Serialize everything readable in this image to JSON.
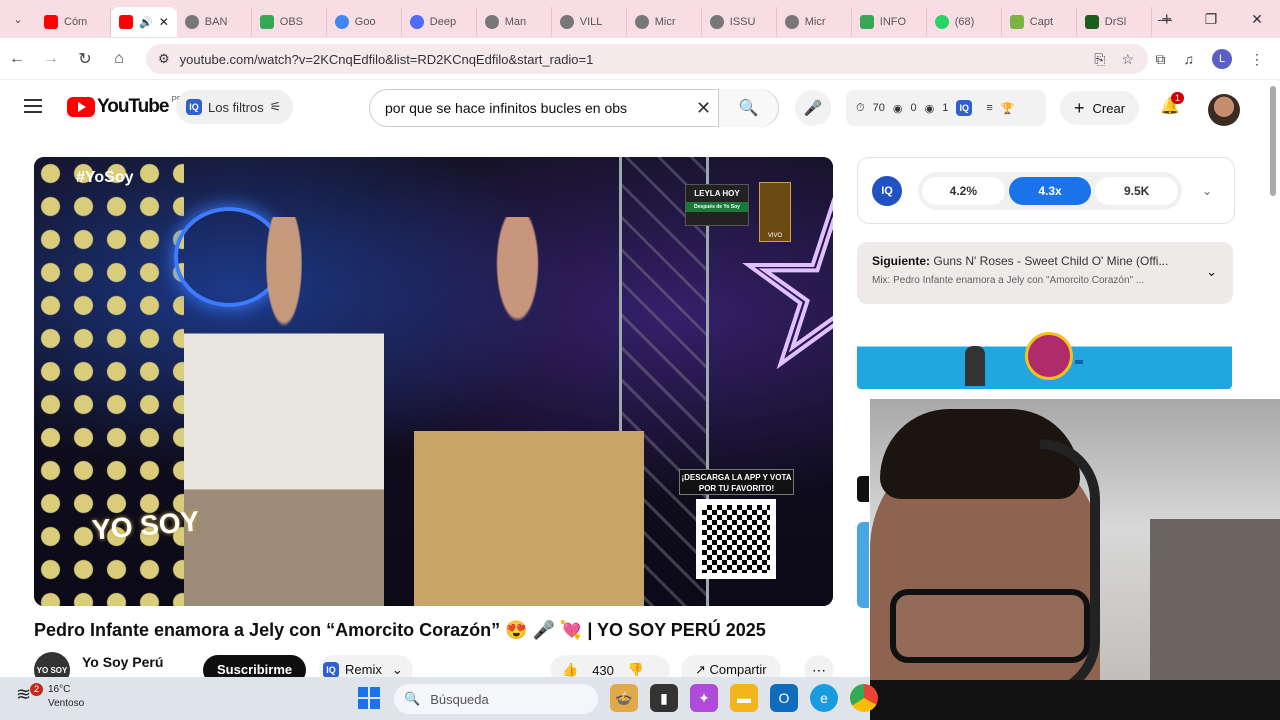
{
  "browser": {
    "tabs": [
      {
        "label": "Cóm",
        "color": "#ff0000"
      },
      {
        "label": "",
        "color": "#ff0000",
        "active": true
      },
      {
        "label": "BAN",
        "color": "#555555"
      },
      {
        "label": "OBS",
        "color": "#34a853"
      },
      {
        "label": "Goo",
        "color": "#4285f4"
      },
      {
        "label": "Deep",
        "color": "#4d6bfe"
      },
      {
        "label": "Man",
        "color": "#555555"
      },
      {
        "label": "VILL",
        "color": "#555555"
      },
      {
        "label": "Micr",
        "color": "#555555"
      },
      {
        "label": "ISSU",
        "color": "#555555"
      },
      {
        "label": "Micr",
        "color": "#555555"
      },
      {
        "label": "INFO",
        "color": "#34a853"
      },
      {
        "label": "(68)",
        "color": "#25d366"
      },
      {
        "label": "Capt",
        "color": "#7cb342"
      },
      {
        "label": "DrSl",
        "color": "#1b5e20"
      }
    ],
    "url": "youtube.com/watch?v=2KCnqEdfilo&list=RD2KCnqEdfilo&start_radio=1",
    "profile_letter": "L"
  },
  "youtube": {
    "logo_text": "YouTube",
    "country_code": "PE",
    "filters_label": "Los filtros",
    "search_value": "por que se hace infinitos bucles en obs",
    "stats": [
      "70",
      "0",
      "1"
    ],
    "create_label": "Crear",
    "notification_count": "1"
  },
  "video": {
    "overlay_hashtag": "#YoSoy",
    "overlay_logo": "YO SOY",
    "overlay_leyla": "LEYLA HOY",
    "overlay_leyla_sub": "Después de Yo Soy",
    "overlay_vivo": "VIVO",
    "overlay_download": "¡DESCARGA LA APP Y VOTA POR TU FAVORITO!",
    "title": "Pedro Infante enamora a Jely con “Amorcito Corazón” 😍 🎤 💘 | YO SOY PERÚ 2025",
    "channel_name": "Yo Soy Perú",
    "channel_avatar": "YO SOY",
    "subscribe_label": "Suscribirme",
    "remix_label": "Remix",
    "likes": "430",
    "share_label": "Compartir"
  },
  "sidebar": {
    "iq_pills": [
      "4.2%",
      "4.3x",
      "9.5K"
    ],
    "next_prefix": "Siguiente:",
    "next_title": "Guns N' Roses - Sweet Child O' Mine (Offi...",
    "mix_label": "Mix: Pedro Infante enamora a Jely con \"Amorcito Corazón\" ..."
  },
  "taskbar": {
    "temperature": "16°C",
    "weather": "Ventoso",
    "weather_badge": "2",
    "search_placeholder": "Búsqueda"
  }
}
